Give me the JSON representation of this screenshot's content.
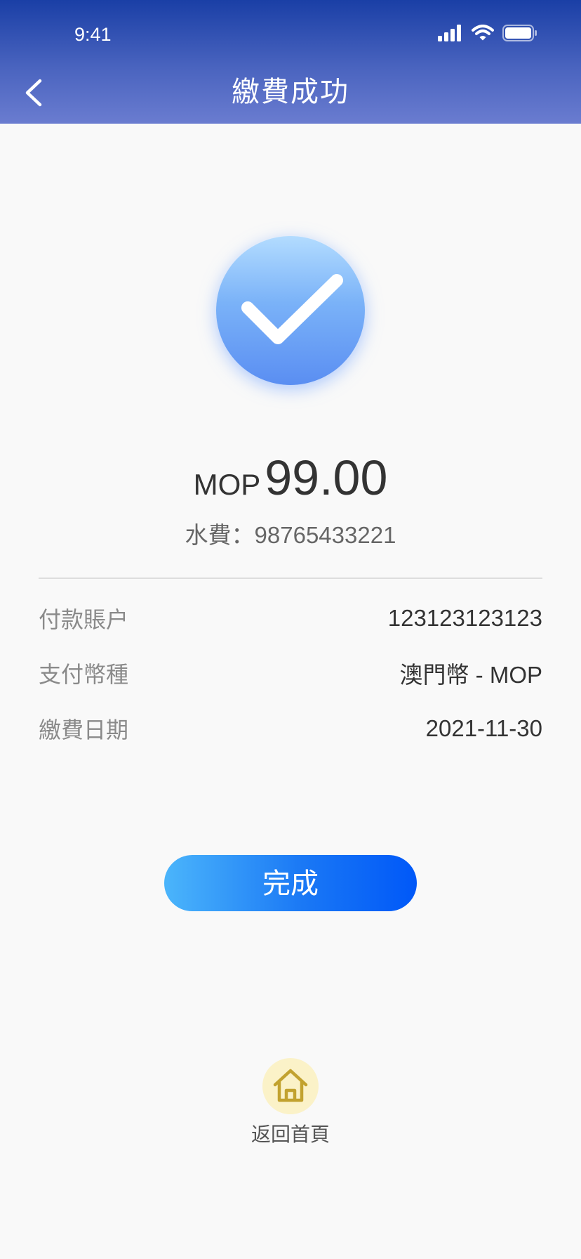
{
  "status_bar": {
    "time": "9:41"
  },
  "header": {
    "title": "繳費成功",
    "back_icon": "chevron-left-icon"
  },
  "success": {
    "icon": "check-circle-icon",
    "currency": "MOP",
    "amount": "99.00",
    "bill_line": "水費：98765433221"
  },
  "details": [
    {
      "label": "付款賬户",
      "value": "123123123123"
    },
    {
      "label": "支付幣種",
      "value": "澳門幣 - MOP"
    },
    {
      "label": "繳費日期",
      "value": "2021-11-30"
    }
  ],
  "actions": {
    "done_label": "完成",
    "home_label": "返回首頁",
    "home_icon": "home-icon"
  },
  "colors": {
    "header_top": "#1a3fa6",
    "header_bottom": "#6a7cd0",
    "button_start": "#4bb5fb",
    "button_end": "#0058f8",
    "home_icon_bg": "#fbf2c8",
    "home_icon_stroke": "#c2a22f"
  }
}
